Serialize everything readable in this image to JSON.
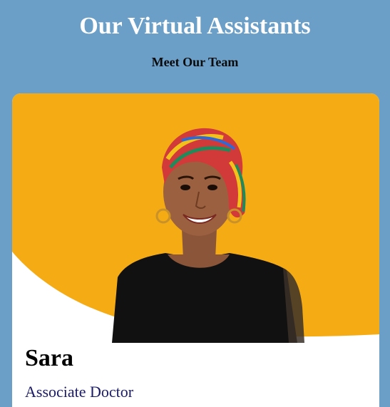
{
  "header": {
    "title": "Our Virtual Assistants",
    "subtitle": "Meet Our Team"
  },
  "card": {
    "name": "Sara",
    "role": "Associate Doctor",
    "photo_background": "#f5ab14"
  },
  "colors": {
    "page_background": "#6b9fc7",
    "card_background": "#ffffff",
    "role_text": "#1a1a66"
  }
}
